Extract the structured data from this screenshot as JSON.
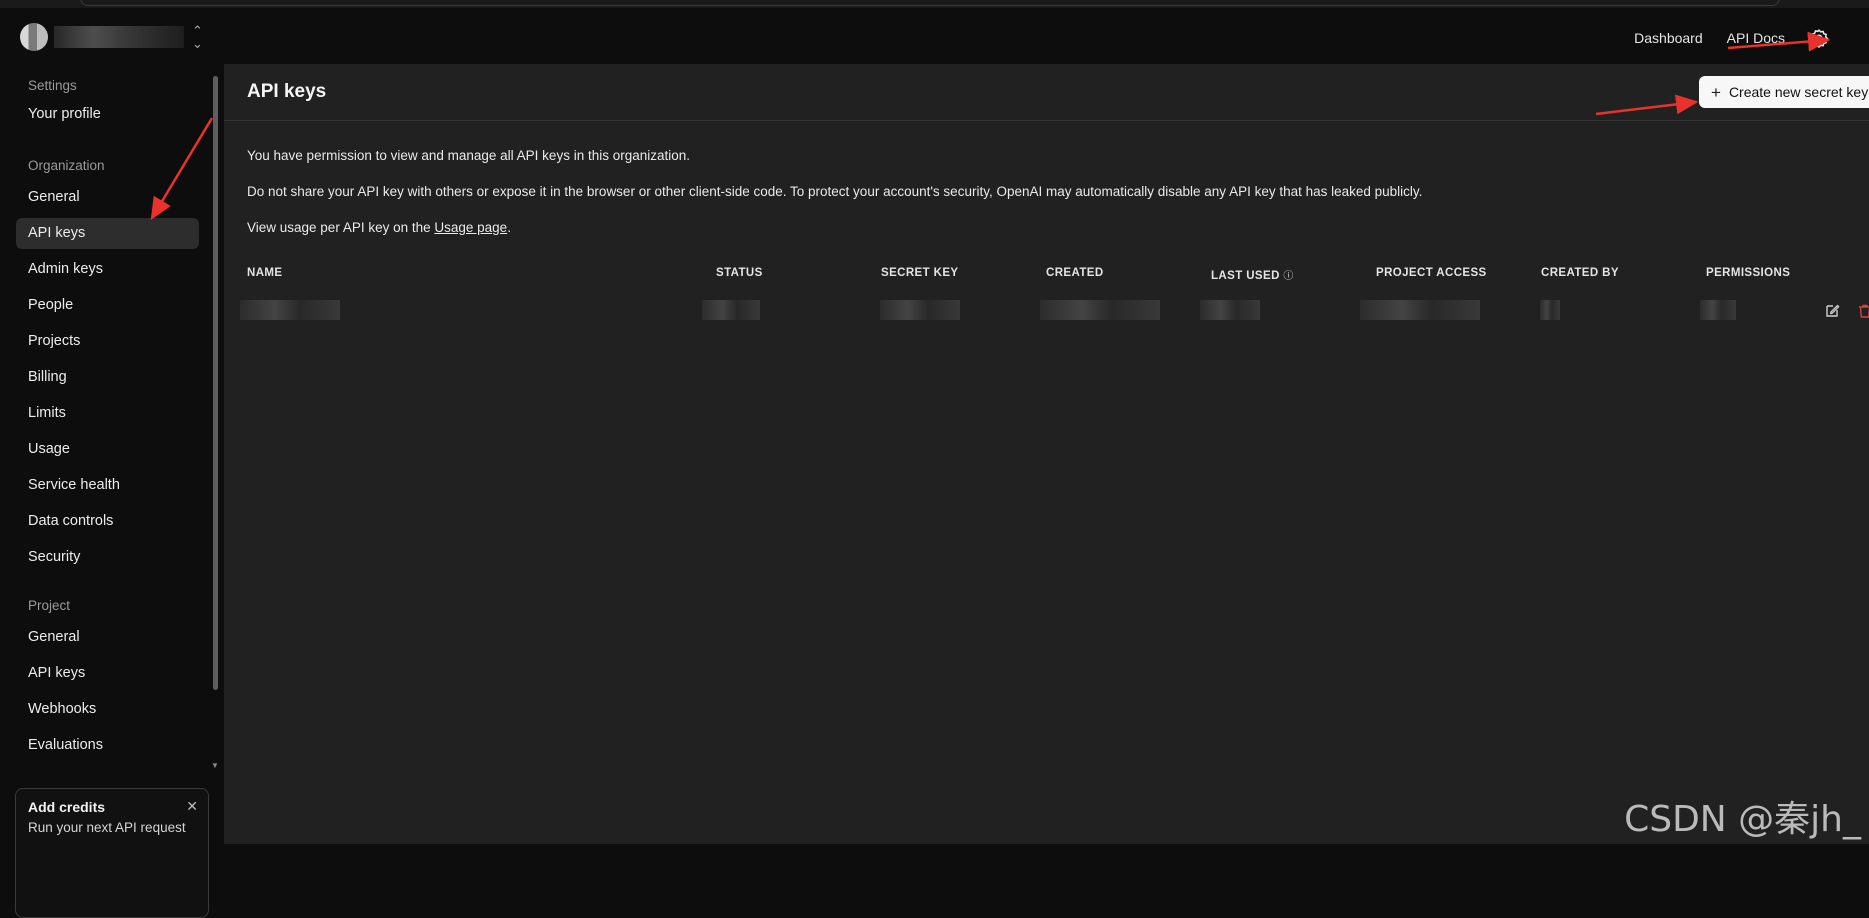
{
  "topbar": {
    "links": [
      "Dashboard",
      "API Docs"
    ],
    "icons": {
      "settings": "gear-icon",
      "org_switch": "chevron-updown-icon"
    }
  },
  "sidebar": {
    "settings_label": "Settings",
    "your_profile": "Your profile",
    "organization_label": "Organization",
    "org_items": [
      "General",
      "API keys",
      "Admin keys",
      "People",
      "Projects",
      "Billing",
      "Limits",
      "Usage",
      "Service health",
      "Data controls",
      "Security"
    ],
    "active_item": "API keys",
    "project_label": "Project",
    "project_items": [
      "General",
      "API keys",
      "Webhooks",
      "Evaluations"
    ],
    "credits": {
      "title": "Add credits",
      "body": "Run your next API request"
    }
  },
  "main": {
    "title": "API keys",
    "create_button": "Create new secret key",
    "info": [
      "You have permission to view and manage all API keys in this organization.",
      "Do not share your API key with others or expose it in the browser or other client-side code. To protect your account's security, OpenAI may automatically disable any API key that has leaked publicly."
    ],
    "usage_prefix": "View usage per API key on the ",
    "usage_link": "Usage page",
    "usage_suffix": ".",
    "table_headers": [
      "NAME",
      "STATUS",
      "SECRET KEY",
      "CREATED",
      "LAST USED",
      "PROJECT ACCESS",
      "CREATED BY",
      "PERMISSIONS"
    ]
  },
  "colors": {
    "main_bg": "#212121",
    "sidebar_bg": "#0d0d0d",
    "active_bg": "#2d2d2d",
    "arrow": "#e8322b",
    "delete_icon": "#d8443a"
  },
  "watermark": "CSDN @秦jh_"
}
